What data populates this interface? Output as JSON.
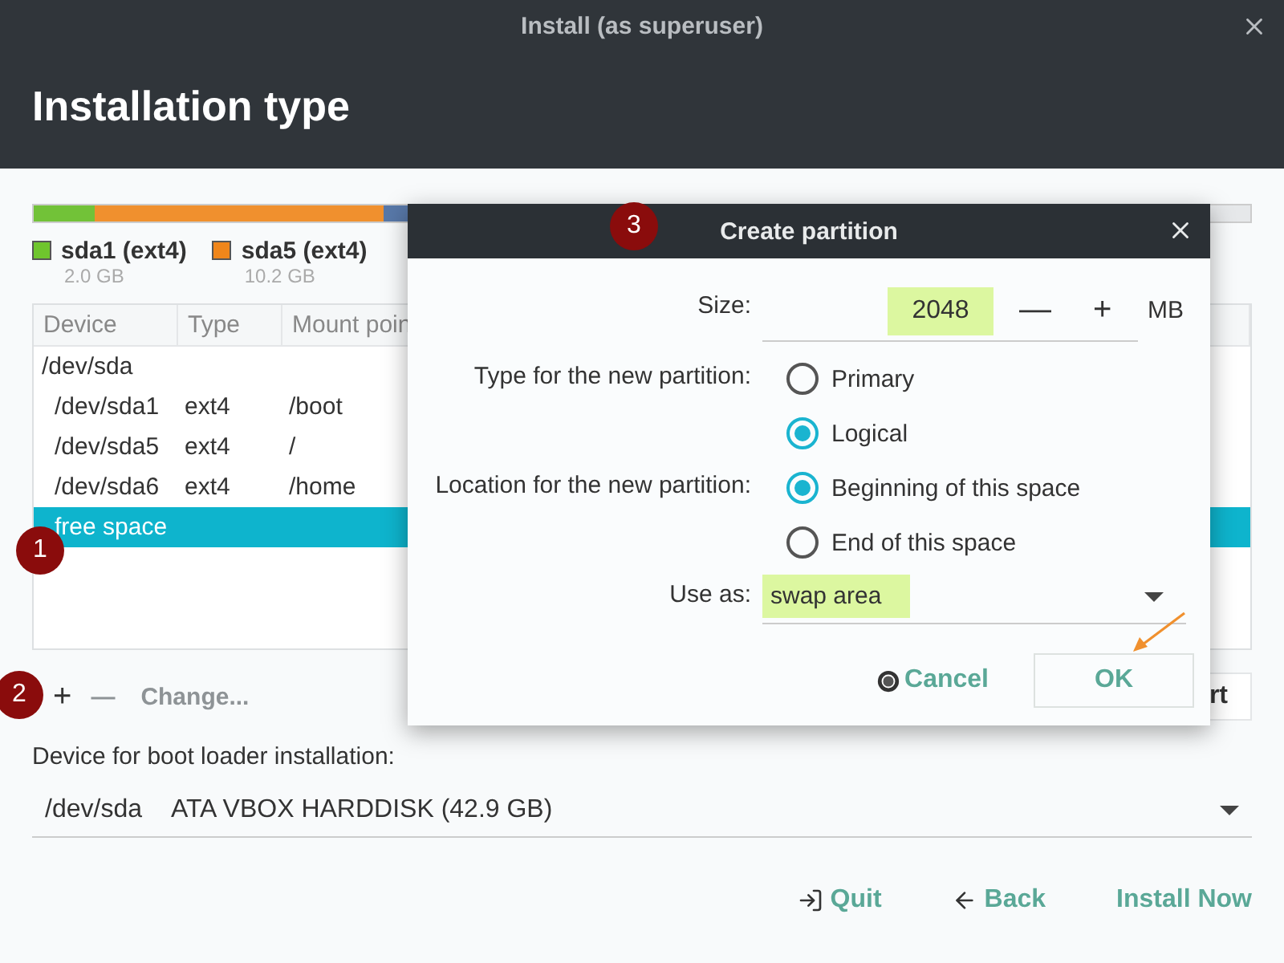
{
  "window": {
    "title": "Install (as superuser)"
  },
  "header": {
    "title": "Installation type"
  },
  "legend": [
    {
      "label": "sda1 (ext4)",
      "size": "2.0 GB",
      "color": "#6fc52d"
    },
    {
      "label": "sda5 (ext4)",
      "size": "10.2 GB",
      "color": "#f0861b"
    }
  ],
  "table": {
    "columns": [
      "Device",
      "Type",
      "Mount poin"
    ],
    "rows": [
      {
        "device": "/dev/sda",
        "selected": false,
        "children": [
          {
            "device": "/dev/sda1",
            "type": "ext4",
            "mount": "/boot",
            "selected": false
          },
          {
            "device": "/dev/sda5",
            "type": "ext4",
            "mount": "/",
            "selected": false
          },
          {
            "device": "/dev/sda6",
            "type": "ext4",
            "mount": "/home",
            "selected": false
          },
          {
            "device": "free space",
            "selected": true
          }
        ]
      }
    ]
  },
  "partition_buttons": [
    {
      "label": "+",
      "disabled": false
    },
    {
      "label": "—",
      "disabled": true
    },
    {
      "label": "Change...",
      "disabled": true
    }
  ],
  "revert_button": {
    "label": "rt"
  },
  "bootloader": {
    "label": "Device for boot loader installation:",
    "device": "/dev/sda",
    "description": "ATA VBOX HARDDISK (42.9 GB)"
  },
  "footer_buttons": [
    {
      "label": "Quit",
      "kind": "quit"
    },
    {
      "label": "Back",
      "kind": "back"
    },
    {
      "label": "Install Now",
      "kind": "plain"
    }
  ],
  "dialog": {
    "title": "Create partition",
    "size": {
      "label": "Size:",
      "value": "2048",
      "minus": "—",
      "plus": "+",
      "unit": "MB"
    },
    "type": {
      "label": "Type for the new partition:",
      "options": [
        {
          "label": "Primary",
          "selected": false
        },
        {
          "label": "Logical",
          "selected": true
        }
      ]
    },
    "location": {
      "label": "Location for the new partition:",
      "options": [
        {
          "label": "Beginning of this space",
          "selected": true
        },
        {
          "label": "End of this space",
          "selected": false
        }
      ]
    },
    "use_as": {
      "label": "Use as:",
      "value": "swap area"
    },
    "buttons": [
      {
        "label": "Cancel",
        "kind": "cancel"
      },
      {
        "label": "OK",
        "kind": "ok"
      }
    ]
  },
  "annotations": [
    {
      "number": "1"
    },
    {
      "number": "2"
    },
    {
      "number": "3"
    }
  ]
}
